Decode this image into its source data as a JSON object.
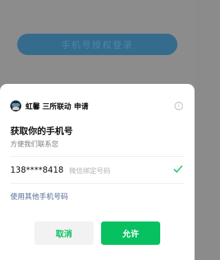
{
  "background": {
    "login_button_label": "手机号授权登录"
  },
  "dialog": {
    "app_name": "虹馨 三所联动",
    "action": "申请",
    "title": "获取你的手机号",
    "subtitle": "方便我们联系您",
    "phone": {
      "number": "138****8418",
      "tag": "微信绑定号码",
      "selected": true
    },
    "other_phone_link": "使用其他手机号码",
    "cancel_label": "取消",
    "allow_label": "允许"
  },
  "colors": {
    "accent_green": "#07c160",
    "link_blue": "#576b95",
    "backdrop_gray": "#8c8c8c"
  }
}
